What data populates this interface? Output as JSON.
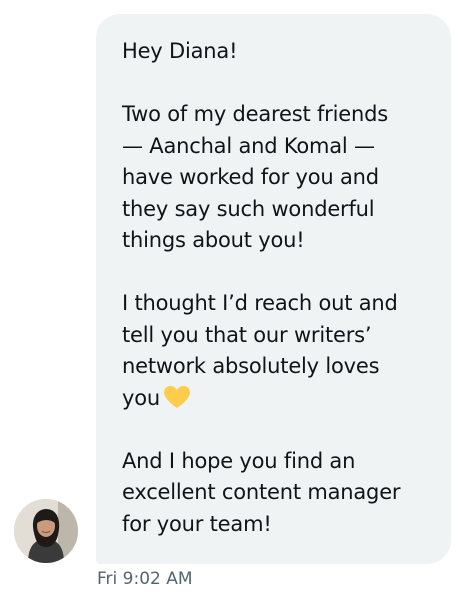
{
  "message": {
    "paragraphs": [
      "Hey Diana!",
      "Two of my dearest friends\n— Aanchal and Komal —\nhave worked for you and\nthey say such wonderful\nthings about you!",
      "I thought I’d reach out and\ntell you that our writers’\nnetwork absolutely loves\nyou",
      "And I hope you find an\nexcellent content manager\nfor your team!"
    ],
    "emoji": "yellow-heart-icon",
    "timestamp": "Fri 9:02 AM"
  },
  "sender": {
    "avatar": "profile-photo"
  },
  "colors": {
    "bubble": "#eff3f4",
    "text": "#0f1419",
    "timestamp": "#536471",
    "heart": "#ffcc4d"
  }
}
